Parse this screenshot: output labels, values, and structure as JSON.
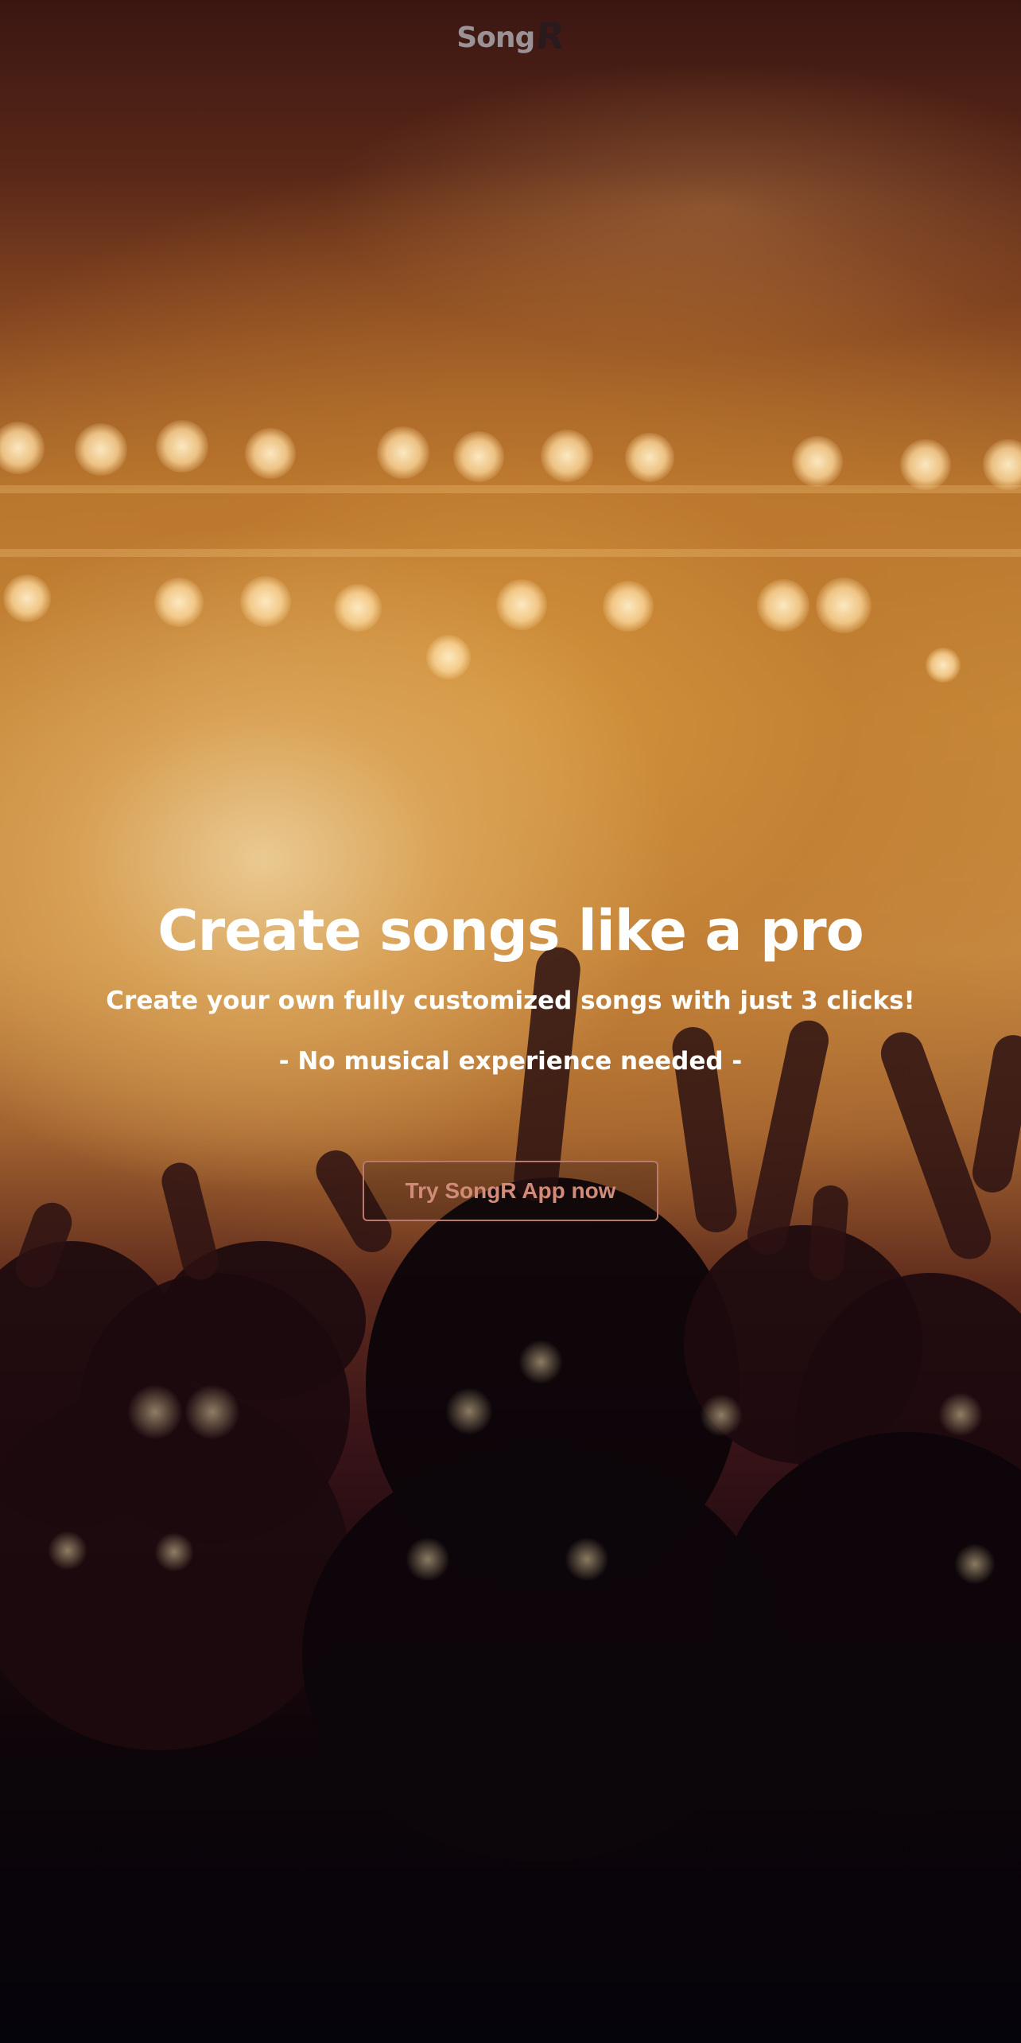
{
  "header": {
    "logo_text_song": "Song",
    "logo_text_r": "R"
  },
  "hero": {
    "title": "Create songs like a pro",
    "subtitle": "Create your own fully customized songs with just 3 clicks!",
    "note": "- No musical experience needed -",
    "cta_label": "Try SongR App now"
  },
  "colors": {
    "text": "#ffffff",
    "cta_text": "#d18b78",
    "cta_border": "#b9796e",
    "logo_song": "#9b9298",
    "logo_r": "#2a1a1e"
  }
}
